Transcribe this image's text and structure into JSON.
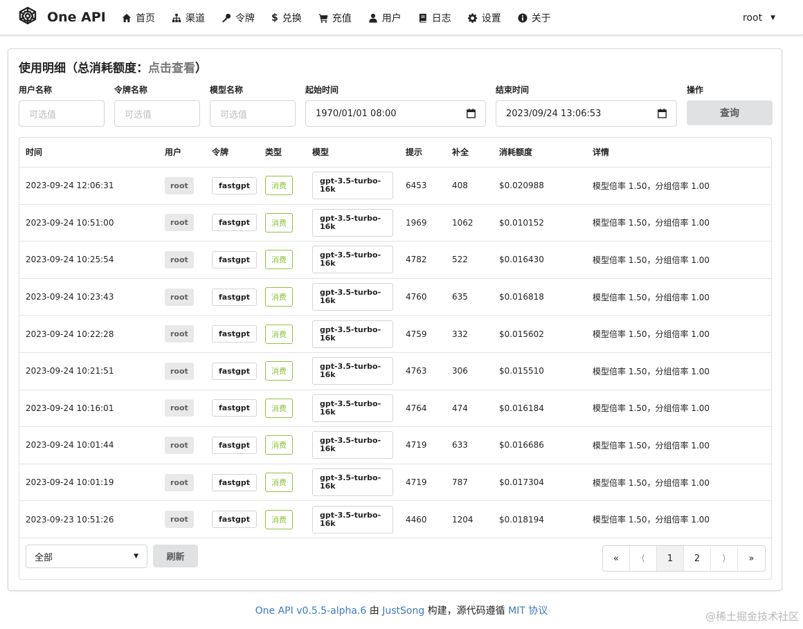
{
  "brand": {
    "name": "One API"
  },
  "nav": [
    {
      "label": "首页",
      "icon": "home-icon"
    },
    {
      "label": "渠道",
      "icon": "sitemap-icon"
    },
    {
      "label": "令牌",
      "icon": "key-icon"
    },
    {
      "label": "兑换",
      "icon": "dollar-icon"
    },
    {
      "label": "充值",
      "icon": "cart-icon"
    },
    {
      "label": "用户",
      "icon": "user-icon"
    },
    {
      "label": "日志",
      "icon": "book-icon"
    },
    {
      "label": "设置",
      "icon": "gear-icon"
    },
    {
      "label": "关于",
      "icon": "info-icon"
    }
  ],
  "user": {
    "name": "root",
    "caret": "▼"
  },
  "card": {
    "title": "使用明细（总消耗额度：",
    "title_link": "点击查看",
    "title_end": "）"
  },
  "filters": {
    "username": {
      "label": "用户名称",
      "placeholder": "可选值"
    },
    "token": {
      "label": "令牌名称",
      "placeholder": "可选值"
    },
    "model": {
      "label": "模型名称",
      "placeholder": "可选值"
    },
    "start": {
      "label": "起始时间",
      "value": "1970/01/01 08:00"
    },
    "end": {
      "label": "结束时间",
      "value": "2023/09/24 13:06:53"
    },
    "action": {
      "label": "操作",
      "button": "查询"
    }
  },
  "table": {
    "headers": [
      "时间",
      "用户",
      "令牌",
      "类型",
      "模型",
      "提示",
      "补全",
      "消耗额度",
      "详情"
    ],
    "rows": [
      {
        "time": "2023-09-24 12:06:31",
        "user": "root",
        "token": "fastgpt",
        "type": "消费",
        "model": "gpt-3.5-turbo-16k",
        "prompt": "6453",
        "completion": "408",
        "quota": "$0.020988",
        "detail": "模型倍率 1.50，分组倍率 1.00"
      },
      {
        "time": "2023-09-24 10:51:00",
        "user": "root",
        "token": "fastgpt",
        "type": "消费",
        "model": "gpt-3.5-turbo-16k",
        "prompt": "1969",
        "completion": "1062",
        "quota": "$0.010152",
        "detail": "模型倍率 1.50，分组倍率 1.00"
      },
      {
        "time": "2023-09-24 10:25:54",
        "user": "root",
        "token": "fastgpt",
        "type": "消费",
        "model": "gpt-3.5-turbo-16k",
        "prompt": "4782",
        "completion": "522",
        "quota": "$0.016430",
        "detail": "模型倍率 1.50，分组倍率 1.00"
      },
      {
        "time": "2023-09-24 10:23:43",
        "user": "root",
        "token": "fastgpt",
        "type": "消费",
        "model": "gpt-3.5-turbo-16k",
        "prompt": "4760",
        "completion": "635",
        "quota": "$0.016818",
        "detail": "模型倍率 1.50，分组倍率 1.00"
      },
      {
        "time": "2023-09-24 10:22:28",
        "user": "root",
        "token": "fastgpt",
        "type": "消费",
        "model": "gpt-3.5-turbo-16k",
        "prompt": "4759",
        "completion": "332",
        "quota": "$0.015602",
        "detail": "模型倍率 1.50，分组倍率 1.00"
      },
      {
        "time": "2023-09-24 10:21:51",
        "user": "root",
        "token": "fastgpt",
        "type": "消费",
        "model": "gpt-3.5-turbo-16k",
        "prompt": "4763",
        "completion": "306",
        "quota": "$0.015510",
        "detail": "模型倍率 1.50，分组倍率 1.00"
      },
      {
        "time": "2023-09-24 10:16:01",
        "user": "root",
        "token": "fastgpt",
        "type": "消费",
        "model": "gpt-3.5-turbo-16k",
        "prompt": "4764",
        "completion": "474",
        "quota": "$0.016184",
        "detail": "模型倍率 1.50，分组倍率 1.00"
      },
      {
        "time": "2023-09-24 10:01:44",
        "user": "root",
        "token": "fastgpt",
        "type": "消费",
        "model": "gpt-3.5-turbo-16k",
        "prompt": "4719",
        "completion": "633",
        "quota": "$0.016686",
        "detail": "模型倍率 1.50，分组倍率 1.00"
      },
      {
        "time": "2023-09-24 10:01:19",
        "user": "root",
        "token": "fastgpt",
        "type": "消费",
        "model": "gpt-3.5-turbo-16k",
        "prompt": "4719",
        "completion": "787",
        "quota": "$0.017304",
        "detail": "模型倍率 1.50，分组倍率 1.00"
      },
      {
        "time": "2023-09-23 10:51:26",
        "user": "root",
        "token": "fastgpt",
        "type": "消费",
        "model": "gpt-3.5-turbo-16k",
        "prompt": "4460",
        "completion": "1204",
        "quota": "$0.018194",
        "detail": "模型倍率 1.50，分组倍率 1.00"
      }
    ]
  },
  "table_footer": {
    "filter_select": "全部",
    "refresh": "刷新",
    "pagination": [
      "«",
      "⟨",
      "1",
      "2",
      "⟩",
      "»"
    ],
    "current_page": "1"
  },
  "footer": {
    "version": "One API v0.5.5-alpha.6",
    "by": " 由 ",
    "author": "JustSong",
    "mid": " 构建，源代码遵循 ",
    "license": "MIT 协议"
  },
  "watermark": "@稀土掘金技术社区",
  "colors": {
    "type_label": "#8ec23f",
    "link": "#3b78c2",
    "button_bg": "#e0e1e2"
  }
}
